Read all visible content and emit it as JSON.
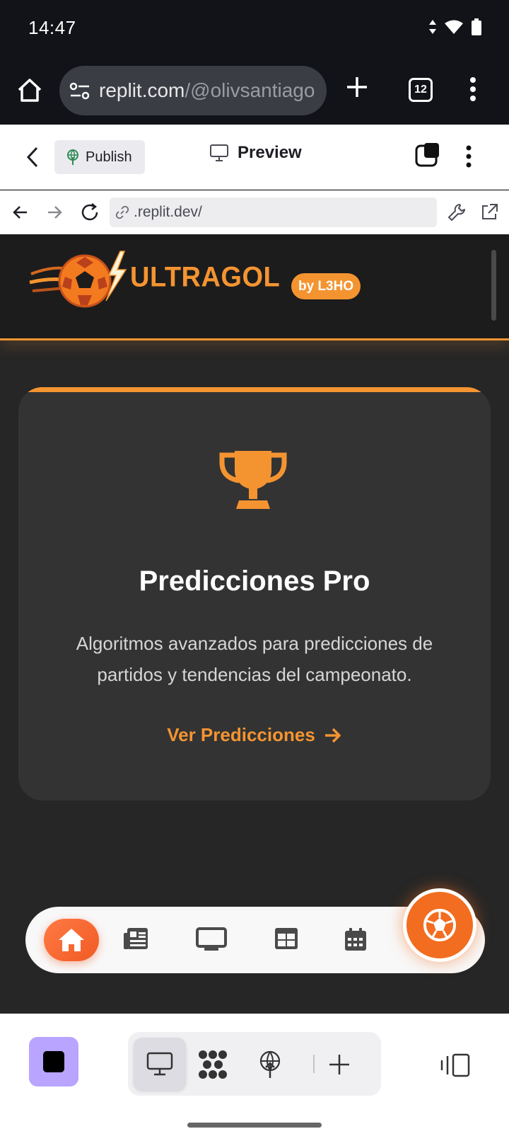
{
  "status_bar": {
    "time": "14:47",
    "icons": [
      "data-arrows-icon",
      "wifi-icon",
      "battery-icon"
    ]
  },
  "browser": {
    "url_host": "replit.com",
    "url_path": "/@olivsantiago",
    "tab_count": "12",
    "icons": [
      "home-icon",
      "site-settings-icon",
      "new-tab-icon",
      "tab-switcher-icon",
      "more-vert-icon"
    ]
  },
  "replit_header": {
    "publish_label": "Publish",
    "preview_label": "Preview"
  },
  "replit_urlbar": {
    "url": ".replit.dev/"
  },
  "app": {
    "logo_text": "ULTRAGOL",
    "badge": "by L3HO",
    "colors": {
      "accent": "#f49431",
      "background": "#262626",
      "card": "#333333"
    },
    "card": {
      "icon": "trophy-icon",
      "title": "Predicciones Pro",
      "description": "Algoritmos avanzados para predicciones de partidos y tendencias del campeonato.",
      "link_label": "Ver Predicciones"
    },
    "nav_icons": [
      "home-icon",
      "newspaper-icon",
      "tv-icon",
      "table-icon",
      "calendar-icon",
      "soccer-ball-icon"
    ]
  },
  "replit_bottombar": {
    "icons": [
      "preview-icon",
      "workflow-icon",
      "deploy-icon",
      "add-icon",
      "split-view-icon"
    ]
  }
}
